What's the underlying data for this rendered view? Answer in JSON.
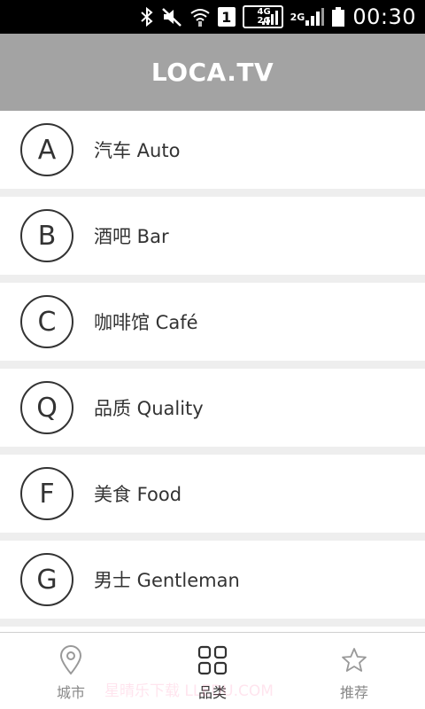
{
  "status_bar": {
    "time": "00:30",
    "sim_label": "1",
    "network_top": "4G",
    "network_bottom": "2G",
    "network_2": "2G",
    "icons": [
      "bluetooth-icon",
      "mute-icon",
      "wifi-icon",
      "sim-icon",
      "signal-icon",
      "battery-icon"
    ]
  },
  "header": {
    "title": "LOCA.TV"
  },
  "categories": [
    {
      "letter": "A",
      "label": "汽车 Auto"
    },
    {
      "letter": "B",
      "label": "酒吧 Bar"
    },
    {
      "letter": "C",
      "label": "咖啡馆 Café"
    },
    {
      "letter": "Q",
      "label": "品质 Quality"
    },
    {
      "letter": "F",
      "label": "美食 Food"
    },
    {
      "letter": "G",
      "label": "男士 Gentleman"
    }
  ],
  "bottom_nav": [
    {
      "label": "城市",
      "icon": "location-pin-icon",
      "active": false
    },
    {
      "label": "品类",
      "icon": "grid-icon",
      "active": true
    },
    {
      "label": "推荐",
      "icon": "star-icon",
      "active": false
    }
  ],
  "watermark": "星晴乐下载 LLEDU.COM",
  "colors": {
    "header_bg": "#a3a3a3",
    "divider": "#eeeeee",
    "text": "#333333",
    "inactive": "#888888"
  }
}
